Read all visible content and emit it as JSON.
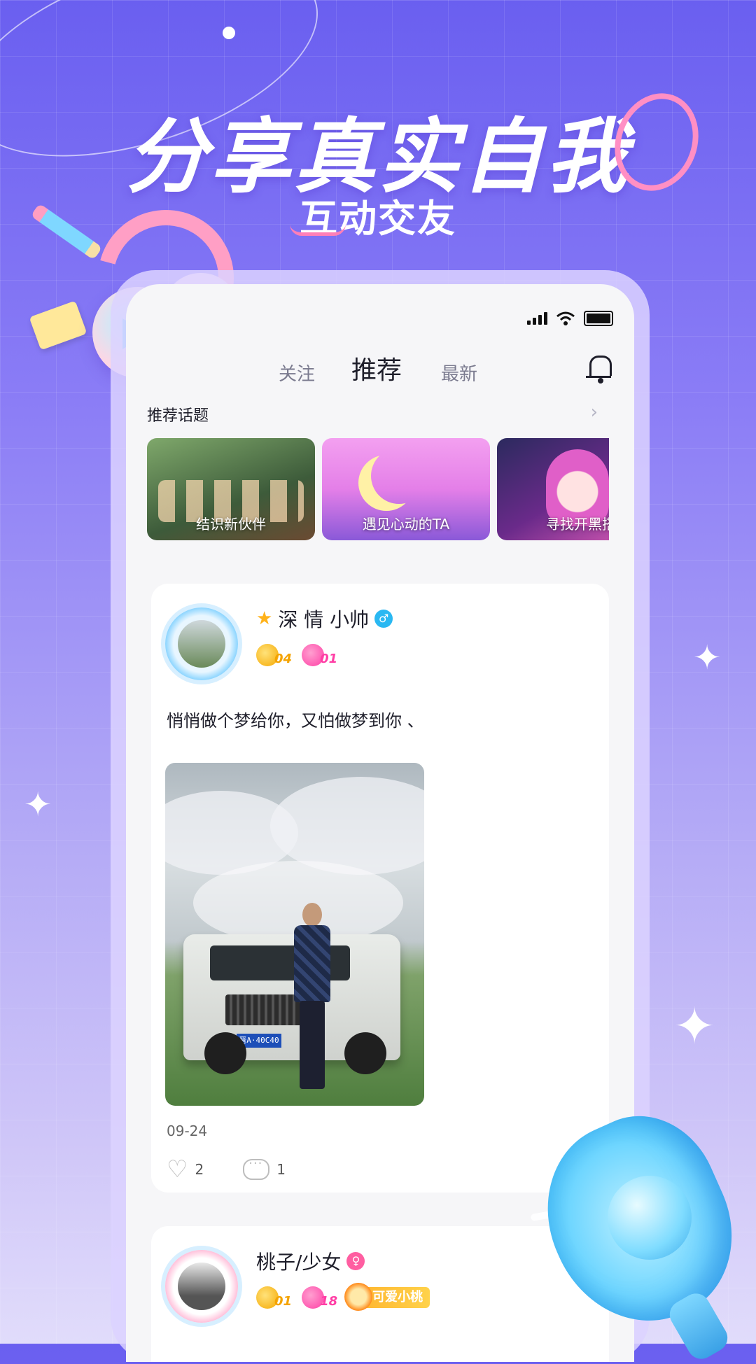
{
  "hero": {
    "headline": "分享真实自我",
    "subheadline": "互动交友"
  },
  "tabs": [
    {
      "label": "关注",
      "active": false
    },
    {
      "label": "推荐",
      "active": true
    },
    {
      "label": "最新",
      "active": false
    }
  ],
  "topics": {
    "title": "推荐话题",
    "items": [
      {
        "label": "结识新伙伴"
      },
      {
        "label": "遇见心动的TA"
      },
      {
        "label": "寻找开黑搭"
      }
    ]
  },
  "posts": [
    {
      "username": "深 情 小帅",
      "gender": "male",
      "badge_gold": "04",
      "badge_pink": "01",
      "text": "悄悄做个梦给你，又怕做梦到你 、",
      "date": "09-24",
      "likes": "2",
      "comments": "1",
      "plate": "晋A·40C40"
    },
    {
      "username": "桃子/少女",
      "gender": "female",
      "badge_gold": "01",
      "badge_pink": "18",
      "tag": "可爱小桃"
    }
  ],
  "colors": {
    "accent_blue": "#2ab8f2",
    "accent_pink": "#ff3ea5",
    "accent_gold": "#f4a300"
  },
  "icons": [
    "signal-icon",
    "wifi-icon",
    "battery-icon",
    "bell-icon",
    "chevron-right-icon",
    "heart-icon",
    "comment-icon",
    "male-icon",
    "female-icon"
  ]
}
